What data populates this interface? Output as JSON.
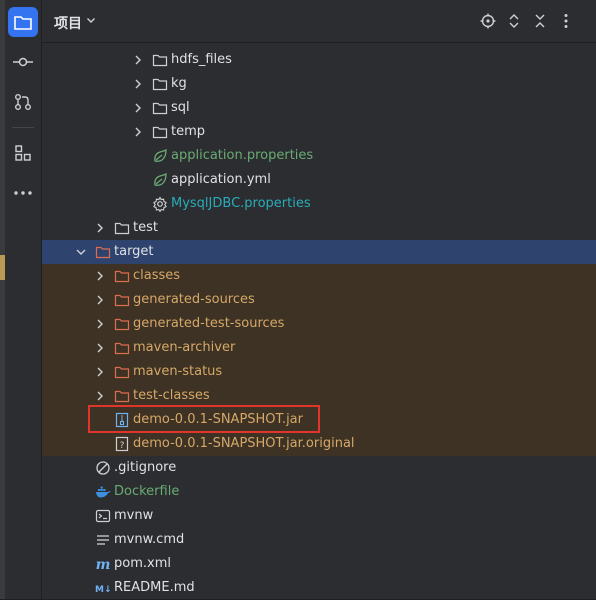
{
  "panel": {
    "title": "项目"
  },
  "rail": {
    "items": [
      "project-icon",
      "commit-icon",
      "pull-requests-icon",
      "structure-icon",
      "more-icon"
    ]
  },
  "header": {
    "icons": [
      "locate-icon",
      "expand-collapse-icon",
      "collapse-all-icon",
      "more-options-icon"
    ]
  },
  "tree": {
    "hdfs_files": "hdfs_files",
    "kg": "kg",
    "sql": "sql",
    "temp": "temp",
    "application_properties": "application.properties",
    "application_yml": "application.yml",
    "mysql_properties": "MysqlJDBC.properties",
    "test": "test",
    "target": "target",
    "classes": "classes",
    "generated_sources": "generated-sources",
    "generated_test_sources": "generated-test-sources",
    "maven_archiver": "maven-archiver",
    "maven_status": "maven-status",
    "test_classes": "test-classes",
    "jar": "demo-0.0.1-SNAPSHOT.jar",
    "jar_original": "demo-0.0.1-SNAPSHOT.jar.original",
    "gitignore": ".gitignore",
    "dockerfile": "Dockerfile",
    "mvnw": "mvnw",
    "mvnw_cmd": "mvnw.cmd",
    "pom": "pom.xml",
    "readme": "README.md"
  },
  "colors": {
    "accent": "#3574f0",
    "highlight_box": "#e0352b",
    "excluded_text": "#d5a86a"
  }
}
